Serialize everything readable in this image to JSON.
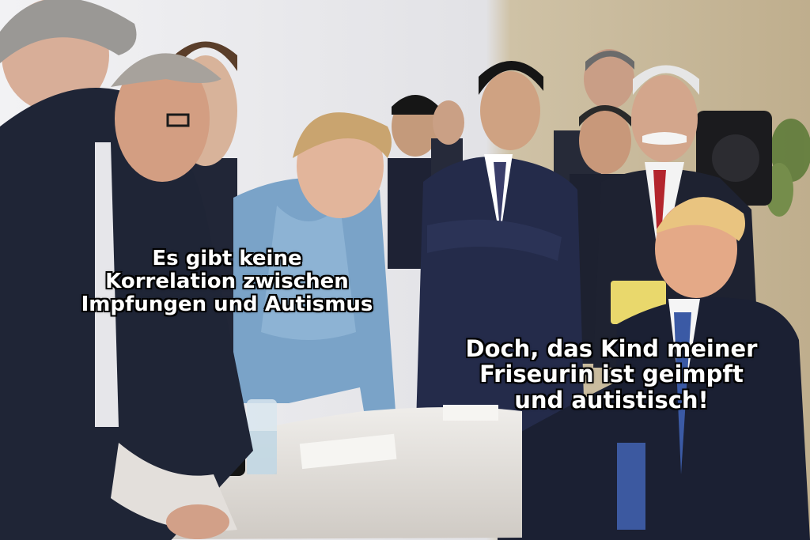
{
  "scene": {
    "colors": {
      "wall": "#dfdfe4",
      "wall_right": "#c9b99a",
      "table_cloth": "#e6e3df",
      "merkel_jacket": "#7ea6c9",
      "dark_suit": "#23283a",
      "caption_text": "#ffffff",
      "caption_outline": "#000000"
    }
  },
  "captions": {
    "left": {
      "lines": [
        "Es gibt keine",
        "Korrelation zwischen",
        "Impfungen und Autismus"
      ]
    },
    "right": {
      "lines": [
        "Doch, das Kind meiner",
        "Friseurin ist geimpft",
        "und autistisch!"
      ]
    }
  }
}
